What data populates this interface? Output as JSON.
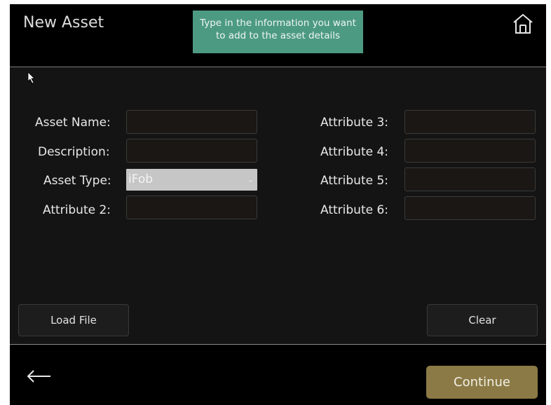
{
  "header": {
    "title": "New Asset",
    "tooltip_line1": "Type in the information you want",
    "tooltip_line2": "to add to the asset details",
    "home_icon": "home-icon"
  },
  "form": {
    "left": [
      {
        "label": "Asset Name:",
        "value": ""
      },
      {
        "label": "Description:",
        "value": ""
      },
      {
        "label": "Asset Type:",
        "value": "iFob"
      },
      {
        "label": "Attribute 2:",
        "value": ""
      }
    ],
    "right": [
      {
        "label": "Attribute 3:",
        "value": ""
      },
      {
        "label": "Attribute 4:",
        "value": ""
      },
      {
        "label": "Attribute 5:",
        "value": ""
      },
      {
        "label": "Attribute 6:",
        "value": ""
      }
    ]
  },
  "actions": {
    "load_file": "Load File",
    "clear": "Clear",
    "continue": "Continue",
    "back_icon": "arrow-left-icon"
  },
  "colors": {
    "tooltip_bg": "#4d9a82",
    "continue_bg": "#8b7a45",
    "panel_bg": "#141414"
  }
}
